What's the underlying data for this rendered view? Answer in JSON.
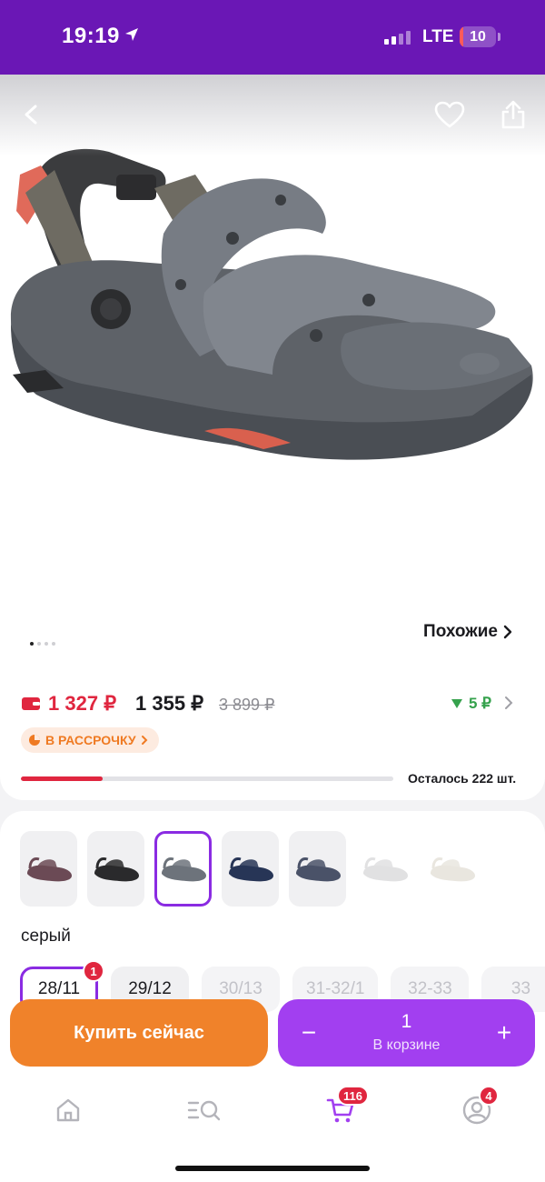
{
  "status_bar": {
    "time": "19:19",
    "network": "LTE",
    "battery": "10",
    "battery_level": 0.1
  },
  "gallery": {
    "page_count": 4,
    "active_page": 0,
    "similar_label": "Похожие"
  },
  "price": {
    "wallet_price": "1 327 ₽",
    "price": "1 355 ₽",
    "old_price": "3 899 ₽",
    "bonus": "5 ₽",
    "installment_label": "В РАССРОЧКУ",
    "stock_label": "Осталось 222 шт.",
    "stock_level": 0.22
  },
  "variants": {
    "color_name": "серый",
    "colors": [
      {
        "name": "sandal-mauve",
        "color": "#6b4a55",
        "selected": false,
        "available": true
      },
      {
        "name": "sandal-black",
        "color": "#2a2a2c",
        "selected": false,
        "available": true
      },
      {
        "name": "sandal-grey",
        "color": "#6d737b",
        "selected": true,
        "available": true
      },
      {
        "name": "sandal-navy",
        "color": "#273556",
        "selected": false,
        "available": true
      },
      {
        "name": "sandal-slate-orange",
        "color": "#4a5268",
        "selected": false,
        "available": true
      },
      {
        "name": "sandal-light-grey",
        "color": "#c9c9cb",
        "selected": false,
        "available": false
      },
      {
        "name": "sandal-beige",
        "color": "#d8d2c6",
        "selected": false,
        "available": false
      }
    ],
    "sizes": [
      {
        "label": "28/11",
        "state": "selected",
        "badge": "1"
      },
      {
        "label": "29/12",
        "state": "available",
        "badge": ""
      },
      {
        "label": "30/13",
        "state": "unavailable",
        "badge": ""
      },
      {
        "label": "31-32/1",
        "state": "unavailable",
        "badge": ""
      },
      {
        "label": "32-33",
        "state": "unavailable",
        "badge": ""
      },
      {
        "label": "33",
        "state": "unavailable",
        "badge": ""
      }
    ]
  },
  "actions": {
    "buy_now": "Купить сейчас",
    "cart_count": "1",
    "cart_label": "В корзине"
  },
  "tabbar": {
    "cart_badge": "116",
    "profile_badge": "4"
  },
  "colors": {
    "brand_purple": "#6a17b5",
    "accent_purple": "#a23ff0",
    "orange": "#f0822a",
    "red": "#e0263f",
    "green": "#36a24d"
  }
}
